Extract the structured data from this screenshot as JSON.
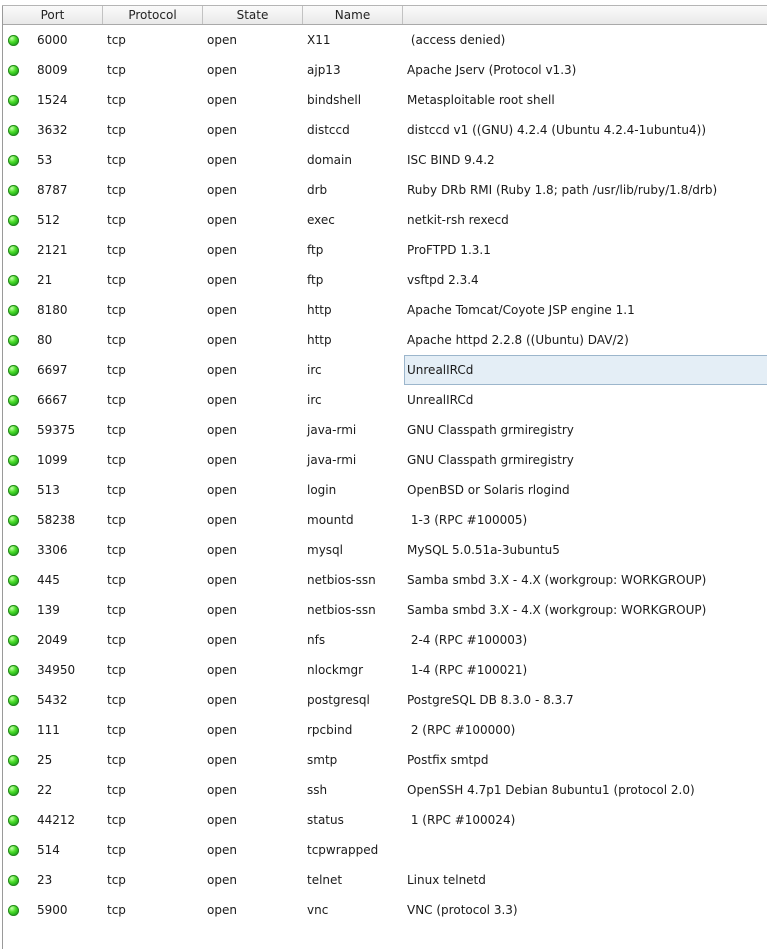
{
  "columns": {
    "port": "Port",
    "protocol": "Protocol",
    "state": "State",
    "name": "Name"
  },
  "status_color": "#3cc92a",
  "selected_row_index": 11,
  "services": [
    {
      "port": "6000",
      "protocol": "tcp",
      "state": "open",
      "name": "X11",
      "version": " (access denied)"
    },
    {
      "port": "8009",
      "protocol": "tcp",
      "state": "open",
      "name": "ajp13",
      "version": "Apache Jserv (Protocol v1.3)"
    },
    {
      "port": "1524",
      "protocol": "tcp",
      "state": "open",
      "name": "bindshell",
      "version": "Metasploitable root shell"
    },
    {
      "port": "3632",
      "protocol": "tcp",
      "state": "open",
      "name": "distccd",
      "version": "distccd v1 ((GNU) 4.2.4 (Ubuntu 4.2.4-1ubuntu4))"
    },
    {
      "port": "53",
      "protocol": "tcp",
      "state": "open",
      "name": "domain",
      "version": "ISC BIND 9.4.2"
    },
    {
      "port": "8787",
      "protocol": "tcp",
      "state": "open",
      "name": "drb",
      "version": "Ruby DRb RMI (Ruby 1.8; path /usr/lib/ruby/1.8/drb)"
    },
    {
      "port": "512",
      "protocol": "tcp",
      "state": "open",
      "name": "exec",
      "version": "netkit-rsh rexecd"
    },
    {
      "port": "2121",
      "protocol": "tcp",
      "state": "open",
      "name": "ftp",
      "version": "ProFTPD 1.3.1"
    },
    {
      "port": "21",
      "protocol": "tcp",
      "state": "open",
      "name": "ftp",
      "version": "vsftpd 2.3.4"
    },
    {
      "port": "8180",
      "protocol": "tcp",
      "state": "open",
      "name": "http",
      "version": "Apache Tomcat/Coyote JSP engine 1.1"
    },
    {
      "port": "80",
      "protocol": "tcp",
      "state": "open",
      "name": "http",
      "version": "Apache httpd 2.2.8 ((Ubuntu) DAV/2)"
    },
    {
      "port": "6697",
      "protocol": "tcp",
      "state": "open",
      "name": "irc",
      "version": "UnrealIRCd"
    },
    {
      "port": "6667",
      "protocol": "tcp",
      "state": "open",
      "name": "irc",
      "version": "UnrealIRCd"
    },
    {
      "port": "59375",
      "protocol": "tcp",
      "state": "open",
      "name": "java-rmi",
      "version": "GNU Classpath grmiregistry"
    },
    {
      "port": "1099",
      "protocol": "tcp",
      "state": "open",
      "name": "java-rmi",
      "version": "GNU Classpath grmiregistry"
    },
    {
      "port": "513",
      "protocol": "tcp",
      "state": "open",
      "name": "login",
      "version": "OpenBSD or Solaris rlogind"
    },
    {
      "port": "58238",
      "protocol": "tcp",
      "state": "open",
      "name": "mountd",
      "version": " 1-3 (RPC #100005)"
    },
    {
      "port": "3306",
      "protocol": "tcp",
      "state": "open",
      "name": "mysql",
      "version": "MySQL 5.0.51a-3ubuntu5"
    },
    {
      "port": "445",
      "protocol": "tcp",
      "state": "open",
      "name": "netbios-ssn",
      "version": "Samba smbd 3.X - 4.X (workgroup: WORKGROUP)"
    },
    {
      "port": "139",
      "protocol": "tcp",
      "state": "open",
      "name": "netbios-ssn",
      "version": "Samba smbd 3.X - 4.X (workgroup: WORKGROUP)"
    },
    {
      "port": "2049",
      "protocol": "tcp",
      "state": "open",
      "name": "nfs",
      "version": " 2-4 (RPC #100003)"
    },
    {
      "port": "34950",
      "protocol": "tcp",
      "state": "open",
      "name": "nlockmgr",
      "version": " 1-4 (RPC #100021)"
    },
    {
      "port": "5432",
      "protocol": "tcp",
      "state": "open",
      "name": "postgresql",
      "version": "PostgreSQL DB 8.3.0 - 8.3.7"
    },
    {
      "port": "111",
      "protocol": "tcp",
      "state": "open",
      "name": "rpcbind",
      "version": " 2 (RPC #100000)"
    },
    {
      "port": "25",
      "protocol": "tcp",
      "state": "open",
      "name": "smtp",
      "version": "Postfix smtpd"
    },
    {
      "port": "22",
      "protocol": "tcp",
      "state": "open",
      "name": "ssh",
      "version": "OpenSSH 4.7p1 Debian 8ubuntu1 (protocol 2.0)"
    },
    {
      "port": "44212",
      "protocol": "tcp",
      "state": "open",
      "name": "status",
      "version": " 1 (RPC #100024)"
    },
    {
      "port": "514",
      "protocol": "tcp",
      "state": "open",
      "name": "tcpwrapped",
      "version": ""
    },
    {
      "port": "23",
      "protocol": "tcp",
      "state": "open",
      "name": "telnet",
      "version": "Linux telnetd"
    },
    {
      "port": "5900",
      "protocol": "tcp",
      "state": "open",
      "name": "vnc",
      "version": "VNC (protocol 3.3)"
    }
  ]
}
